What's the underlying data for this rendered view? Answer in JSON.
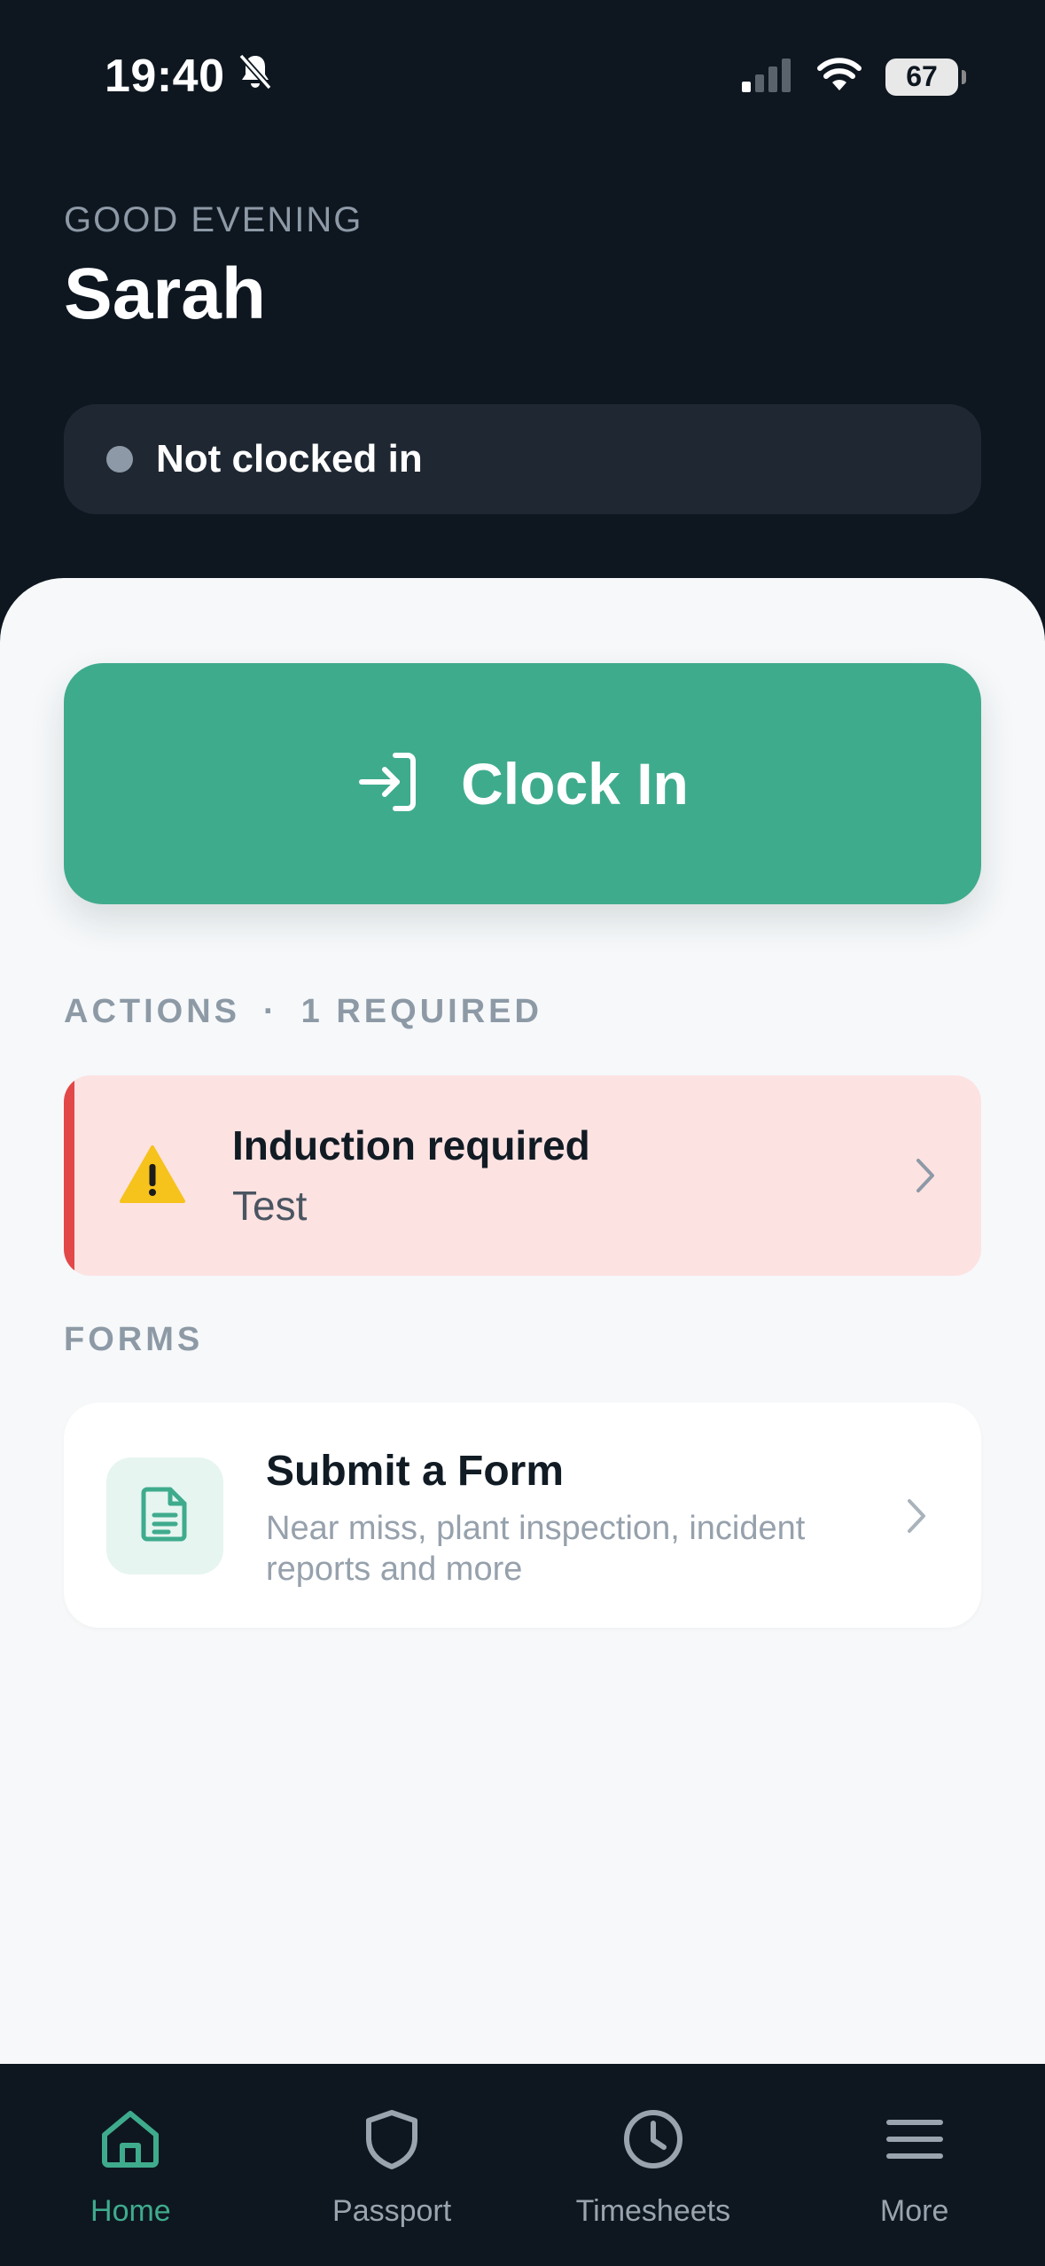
{
  "status_bar": {
    "time": "19:40",
    "battery": "67"
  },
  "header": {
    "greeting": "GOOD EVENING",
    "user_name": "Sarah",
    "clock_status": "Not clocked in"
  },
  "clock_in": {
    "label": "Clock In"
  },
  "actions": {
    "title": "ACTIONS",
    "separator": "·",
    "required_count": "1 REQUIRED",
    "items": [
      {
        "title": "Induction required",
        "subtitle": "Test"
      }
    ]
  },
  "forms": {
    "title": "FORMS",
    "card": {
      "title": "Submit a Form",
      "description": "Near miss, plant inspection, incident reports and more"
    }
  },
  "bottom_nav": {
    "items": [
      {
        "label": "Home",
        "icon": "home-icon",
        "active": true
      },
      {
        "label": "Passport",
        "icon": "shield-icon",
        "active": false
      },
      {
        "label": "Timesheets",
        "icon": "clock-icon",
        "active": false
      },
      {
        "label": "More",
        "icon": "menu-icon",
        "active": false
      }
    ]
  },
  "colors": {
    "background_dark": "#0e1720",
    "accent": "#3fab8d",
    "alert_red": "#e34848",
    "alert_bg": "#fde2e2",
    "panel_bg": "#f6f8fa"
  }
}
